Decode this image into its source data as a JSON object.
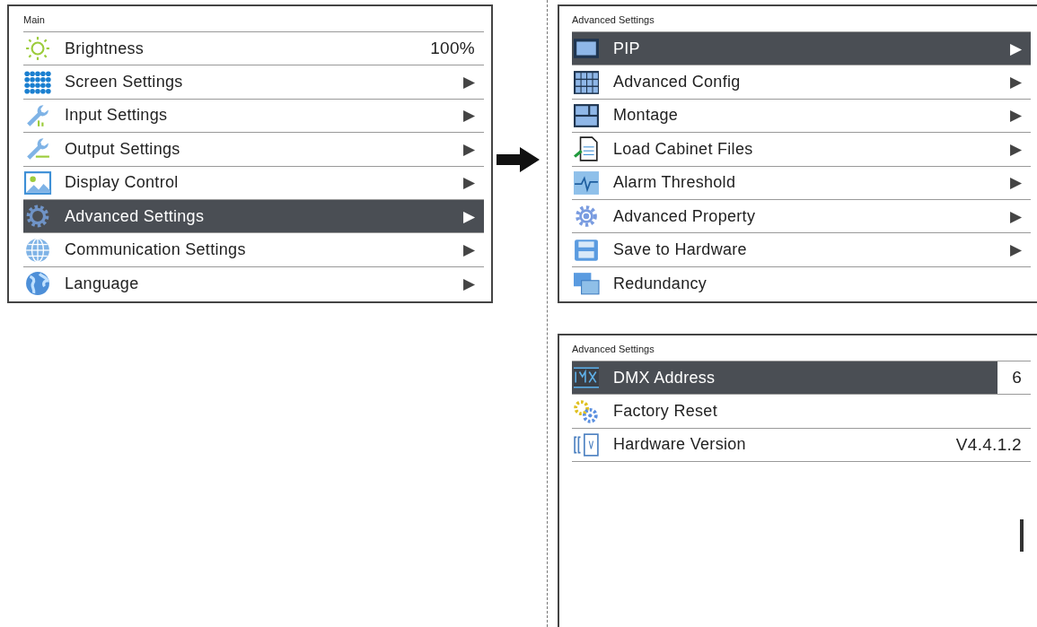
{
  "main_menu": {
    "title": "Main",
    "items": [
      {
        "label": "Brightness",
        "value": "100%",
        "selected": false
      },
      {
        "label": "Screen Settings",
        "arrow": "▶",
        "selected": false
      },
      {
        "label": "Input Settings",
        "arrow": "▶",
        "selected": false
      },
      {
        "label": "Output Settings",
        "arrow": "▶",
        "selected": false
      },
      {
        "label": "Display Control",
        "arrow": "▶",
        "selected": false
      },
      {
        "label": "Advanced Settings",
        "arrow": "▶",
        "selected": true
      },
      {
        "label": "Communication Settings",
        "arrow": "▶",
        "selected": false
      },
      {
        "label": "Language",
        "arrow": "▶",
        "selected": false
      }
    ]
  },
  "advanced_menu": {
    "title": "Advanced Settings",
    "items": [
      {
        "label": "PIP",
        "arrow": "▶",
        "selected": true
      },
      {
        "label": "Advanced Config",
        "arrow": "▶",
        "selected": false
      },
      {
        "label": "Montage",
        "arrow": "▶",
        "selected": false
      },
      {
        "label": "Load Cabinet Files",
        "arrow": "▶",
        "selected": false
      },
      {
        "label": "Alarm Threshold",
        "arrow": "▶",
        "selected": false
      },
      {
        "label": "Advanced Property",
        "arrow": "▶",
        "selected": false
      },
      {
        "label": "Save  to Hardware",
        "arrow": "▶",
        "selected": false
      },
      {
        "label": "Redundancy",
        "selected": false
      }
    ]
  },
  "advanced_menu_page_2": {
    "title": "Advanced Settings",
    "items": [
      {
        "label": "DMX Address",
        "value": "6",
        "selected": true
      },
      {
        "label": "Factory Reset",
        "selected": false
      },
      {
        "label": "Hardware Version",
        "value": "V4.4.1.2",
        "selected": false
      }
    ]
  }
}
